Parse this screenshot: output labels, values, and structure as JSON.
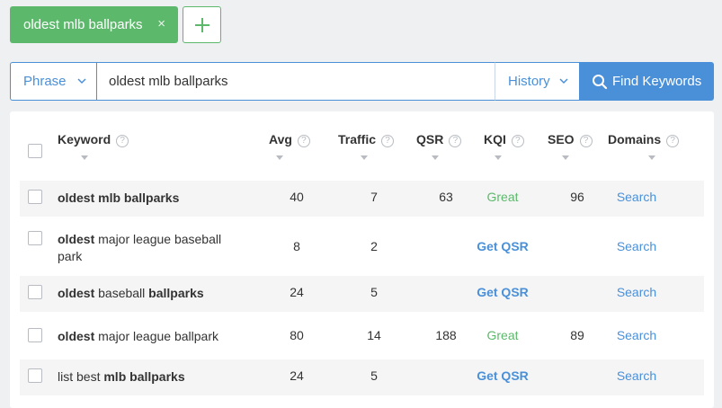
{
  "tag": {
    "label": "oldest mlb ballparks",
    "close": "×"
  },
  "search": {
    "mode": "Phrase",
    "query": "oldest mlb ballparks",
    "history_label": "History",
    "find_label": "Find Keywords"
  },
  "table": {
    "headers": [
      "Keyword",
      "Avg",
      "Traffic",
      "QSR",
      "KQI",
      "SEO",
      "Domains"
    ],
    "rows": [
      {
        "keyword": [
          {
            "t": "oldest mlb ballparks",
            "b": true
          }
        ],
        "avg": "40",
        "traffic": "7",
        "qsr": "63",
        "kqi": "Great",
        "seo": "96",
        "domains": "Search"
      },
      {
        "keyword": [
          {
            "t": "oldest",
            "b": true
          },
          {
            "t": " major league baseball park",
            "b": false
          }
        ],
        "avg": "8",
        "traffic": "2",
        "qsr": "",
        "kqi": "Get QSR",
        "seo": "",
        "domains": "Search"
      },
      {
        "keyword": [
          {
            "t": "oldest",
            "b": true
          },
          {
            "t": " baseball ",
            "b": false
          },
          {
            "t": "ballparks",
            "b": true
          }
        ],
        "avg": "24",
        "traffic": "5",
        "qsr": "",
        "kqi": "Get QSR",
        "seo": "",
        "domains": "Search"
      },
      {
        "keyword": [
          {
            "t": "oldest",
            "b": true
          },
          {
            "t": " major league ballpark",
            "b": false
          }
        ],
        "avg": "80",
        "traffic": "14",
        "qsr": "188",
        "kqi": "Great",
        "seo": "89",
        "domains": "Search"
      },
      {
        "keyword": [
          {
            "t": "list best ",
            "b": false
          },
          {
            "t": "mlb ballparks",
            "b": true
          }
        ],
        "avg": "24",
        "traffic": "5",
        "qsr": "",
        "kqi": "Get QSR",
        "seo": "",
        "domains": "Search"
      }
    ]
  },
  "colors": {
    "accent": "#4a90d9",
    "tag_green": "#5cb96b",
    "great_green": "#5cb96b"
  }
}
